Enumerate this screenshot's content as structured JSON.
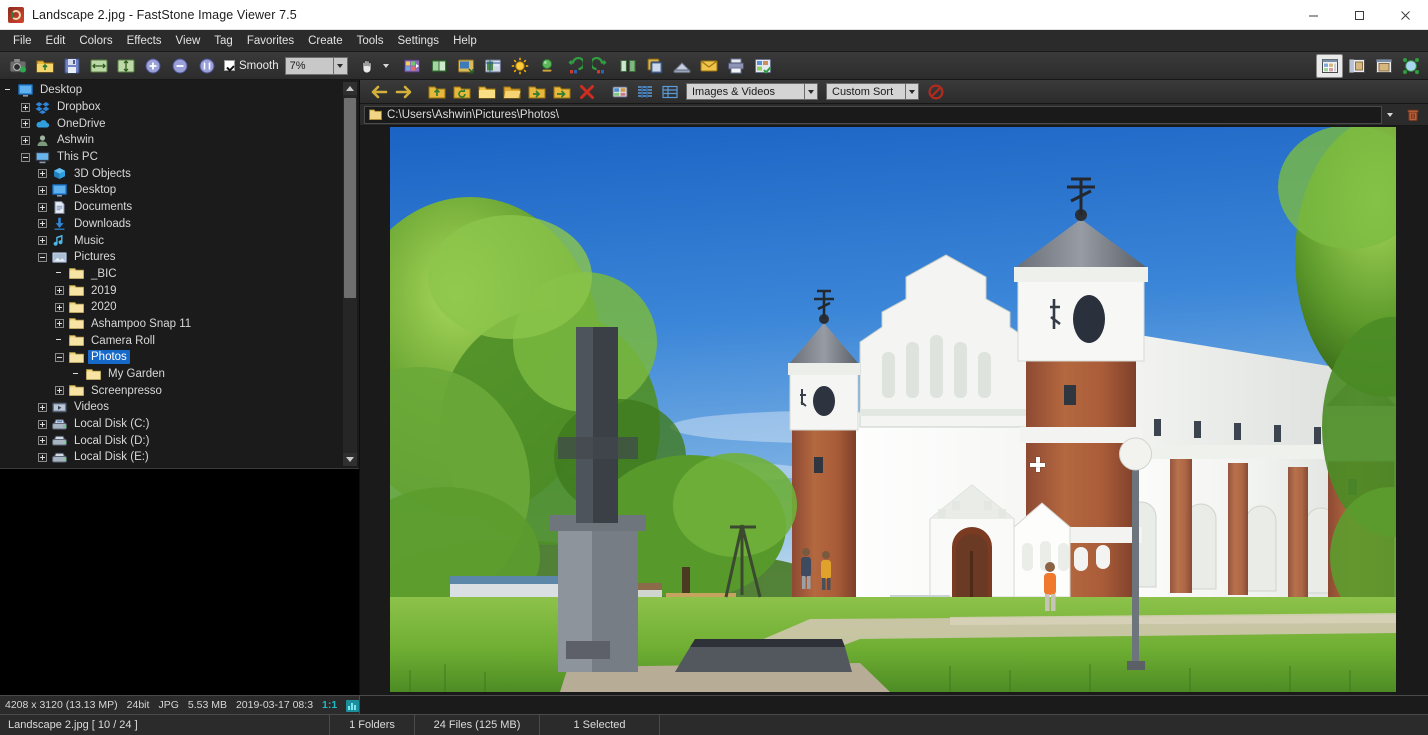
{
  "window": {
    "title": "Landscape 2.jpg  -  FastStone Image Viewer 7.5",
    "app_icon": "faststone-logo-icon",
    "minimize_label": "Minimize",
    "maximize_label": "Maximize",
    "close_label": "Close"
  },
  "menubar": {
    "items": [
      {
        "label": "File"
      },
      {
        "label": "Edit"
      },
      {
        "label": "Colors"
      },
      {
        "label": "Effects"
      },
      {
        "label": "View"
      },
      {
        "label": "Tag"
      },
      {
        "label": "Favorites"
      },
      {
        "label": "Create"
      },
      {
        "label": "Tools"
      },
      {
        "label": "Settings"
      },
      {
        "label": "Help"
      }
    ]
  },
  "toolbar": {
    "smooth_label": "Smooth",
    "smooth_checked": true,
    "zoom_value": "7%",
    "buttons": [
      {
        "name": "screen-capture-icon",
        "title": "Screen Capture"
      },
      {
        "name": "open-folder-icon",
        "title": "Open"
      },
      {
        "name": "save-as-icon",
        "title": "Save As"
      },
      {
        "name": "fit-width-icon",
        "title": "Fit to Width"
      },
      {
        "name": "fit-height-icon",
        "title": "Fit to Height"
      },
      {
        "name": "zoom-in-icon",
        "title": "Zoom In"
      },
      {
        "name": "zoom-out-icon",
        "title": "Zoom Out"
      },
      {
        "name": "actual-size-icon",
        "title": "Actual Size"
      },
      {
        "name": "hand-tool-icon",
        "title": "Hand / Drag Mode"
      },
      {
        "name": "slideshow-icon",
        "title": "Slide Show"
      },
      {
        "name": "compare-icon",
        "title": "Compare Selected Images"
      },
      {
        "name": "resize-icon",
        "title": "Resize / Resample"
      },
      {
        "name": "crop-board-icon",
        "title": "Crop Board"
      },
      {
        "name": "adjust-lighting-icon",
        "title": "Adjust Lighting"
      },
      {
        "name": "adjust-colors-icon",
        "title": "Adjust Colors"
      },
      {
        "name": "rotate-left-icon",
        "title": "Rotate Left"
      },
      {
        "name": "rotate-right-icon",
        "title": "Rotate Right"
      },
      {
        "name": "flip-icon",
        "title": "Flip Horizontal"
      },
      {
        "name": "clone-stamp-icon",
        "title": "Clone Stamp"
      },
      {
        "name": "scan-icon",
        "title": "Acquire from Scanner"
      },
      {
        "name": "email-icon",
        "title": "E-mail"
      },
      {
        "name": "print-icon",
        "title": "Print"
      },
      {
        "name": "contact-sheet-icon",
        "title": "Contact Sheet Builder"
      }
    ],
    "right_buttons": [
      {
        "name": "layout-thumbnails-icon",
        "title": "Thumbnail View",
        "active": true
      },
      {
        "name": "layout-filmstrip-icon",
        "title": "Filmstrip View",
        "active": false
      },
      {
        "name": "layout-preview-icon",
        "title": "Preview View",
        "active": false
      },
      {
        "name": "fullscreen-icon",
        "title": "Full Screen",
        "active": false
      }
    ]
  },
  "navbar": {
    "buttons": [
      {
        "name": "back-arrow-icon",
        "title": "Back"
      },
      {
        "name": "forward-arrow-icon",
        "title": "Forward"
      },
      {
        "name": "folder-up-icon",
        "title": "Up One Level"
      },
      {
        "name": "folder-refresh-icon",
        "title": "Refresh"
      },
      {
        "name": "new-folder-icon",
        "title": "New Folder"
      },
      {
        "name": "folder-open-icon",
        "title": "Open Folder"
      },
      {
        "name": "copy-to-folder-icon",
        "title": "Copy To Folder"
      },
      {
        "name": "move-to-folder-icon",
        "title": "Move To Folder"
      },
      {
        "name": "delete-icon",
        "title": "Delete"
      },
      {
        "name": "thumbnail-mode-icon",
        "title": "Thumbnail Mode"
      },
      {
        "name": "list-mode-icon",
        "title": "List Mode"
      },
      {
        "name": "detail-mode-icon",
        "title": "Detail Mode"
      }
    ],
    "filter_value": "Images & Videos",
    "sort_value": "Custom Sort",
    "stop_button": "stop-icon"
  },
  "address": {
    "path": "C:\\Users\\Ashwin\\Pictures\\Photos\\",
    "folder_icon": "folder-icon",
    "dropdown_icon": "chevron-down-icon",
    "trash_icon": "trash-icon"
  },
  "tree": {
    "items": [
      {
        "label": "Desktop",
        "indent": 0,
        "expander": "none",
        "icon": "desktop-icon",
        "selected": false
      },
      {
        "label": "Dropbox",
        "indent": 1,
        "expander": "plus",
        "icon": "dropbox-icon",
        "selected": false
      },
      {
        "label": "OneDrive",
        "indent": 1,
        "expander": "plus",
        "icon": "onedrive-icon",
        "selected": false
      },
      {
        "label": "Ashwin",
        "indent": 1,
        "expander": "plus",
        "icon": "user-icon",
        "selected": false
      },
      {
        "label": "This PC",
        "indent": 1,
        "expander": "minus",
        "icon": "pc-icon",
        "selected": false
      },
      {
        "label": "3D Objects",
        "indent": 2,
        "expander": "plus",
        "icon": "cube-icon",
        "selected": false
      },
      {
        "label": "Desktop",
        "indent": 2,
        "expander": "plus",
        "icon": "desktop-icon",
        "selected": false
      },
      {
        "label": "Documents",
        "indent": 2,
        "expander": "plus",
        "icon": "document-icon",
        "selected": false
      },
      {
        "label": "Downloads",
        "indent": 2,
        "expander": "plus",
        "icon": "download-icon",
        "selected": false
      },
      {
        "label": "Music",
        "indent": 2,
        "expander": "plus",
        "icon": "music-icon",
        "selected": false
      },
      {
        "label": "Pictures",
        "indent": 2,
        "expander": "minus",
        "icon": "pictures-icon",
        "selected": false
      },
      {
        "label": "_BIC",
        "indent": 3,
        "expander": "none",
        "icon": "folder-icon",
        "selected": false
      },
      {
        "label": "2019",
        "indent": 3,
        "expander": "plus",
        "icon": "folder-icon",
        "selected": false
      },
      {
        "label": "2020",
        "indent": 3,
        "expander": "plus",
        "icon": "folder-icon",
        "selected": false
      },
      {
        "label": "Ashampoo Snap 11",
        "indent": 3,
        "expander": "plus",
        "icon": "folder-icon",
        "selected": false
      },
      {
        "label": "Camera Roll",
        "indent": 3,
        "expander": "none",
        "icon": "folder-icon",
        "selected": false
      },
      {
        "label": "Photos",
        "indent": 3,
        "expander": "minus",
        "icon": "folder-icon",
        "selected": true
      },
      {
        "label": "My Garden",
        "indent": 4,
        "expander": "none",
        "icon": "folder-icon",
        "selected": false
      },
      {
        "label": "Screenpresso",
        "indent": 3,
        "expander": "plus",
        "icon": "folder-icon",
        "selected": false
      },
      {
        "label": "Videos",
        "indent": 2,
        "expander": "plus",
        "icon": "video-icon",
        "selected": false
      },
      {
        "label": "Local Disk (C:)",
        "indent": 2,
        "expander": "plus",
        "icon": "drive-sys-icon",
        "selected": false
      },
      {
        "label": "Local Disk (D:)",
        "indent": 2,
        "expander": "plus",
        "icon": "drive-icon",
        "selected": false
      },
      {
        "label": "Local Disk (E:)",
        "indent": 2,
        "expander": "plus",
        "icon": "drive-icon",
        "selected": false
      }
    ]
  },
  "image": {
    "alt": "Murovanka fortified church with white walls, brick towers and conical roofs under a blue sky",
    "caption": "Landscape 2.jpg"
  },
  "statusbar_image": {
    "dimensions": "4208 x 3120 (13.13 MP)",
    "bit_depth": "24bit",
    "format": "JPG",
    "filesize": "5.53 MB",
    "datetime": "2019-03-17 08:3",
    "ratio": "1:1",
    "icons": [
      "histogram-icon",
      "exif-icon"
    ]
  },
  "statusbar_main": {
    "filename": "Landscape 2.jpg [ 10 / 24 ]",
    "folders": "1 Folders",
    "files": "24 Files (125 MB)",
    "selected": "1 Selected"
  },
  "colors": {
    "accent_selected": "#1669c9",
    "titlebar_bg": "#ffffff",
    "chrome_bg": "#2b2b2b",
    "toolbar_top": "#3a3a3a",
    "panel_bg": "#1b1b1b",
    "text": "#dcdcdc",
    "ratio_teal": "#1fb8c4",
    "folder_yellow": "#f3d98b",
    "sky_blue": "#2f7fd6"
  }
}
